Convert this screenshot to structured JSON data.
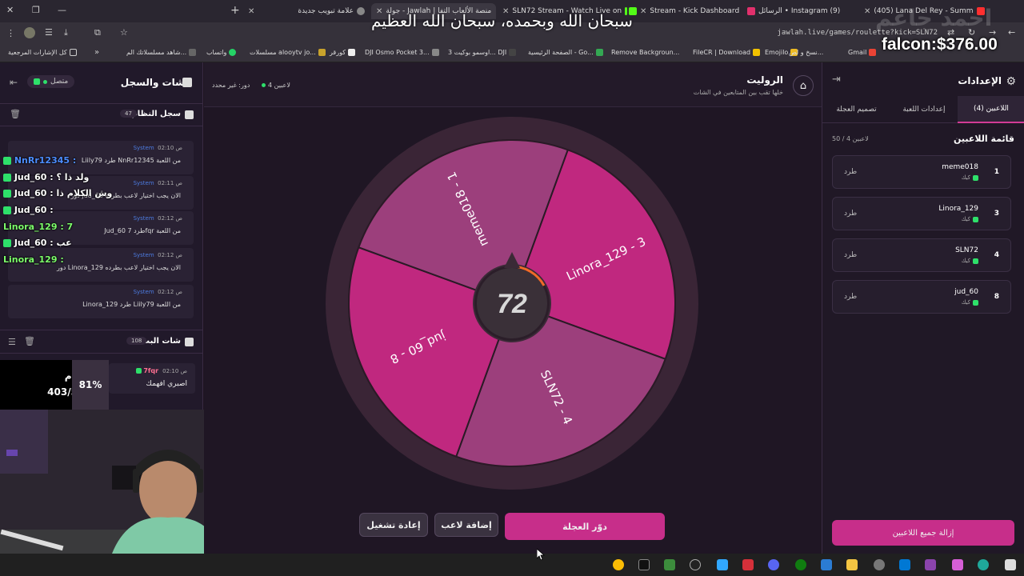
{
  "browser": {
    "tabs": [
      {
        "title": "(405) Lana Del Rey - Summ",
        "icon_color": "#ff2f2f"
      },
      {
        "title": "الرسائل • Instagram (9)",
        "icon_color": "#e1306c"
      },
      {
        "title": "Stream - Kick Dashboard",
        "icon_color": "#53fc18"
      },
      {
        "title": "SLN72 Stream - Watch Live on",
        "icon_color": "#53fc18"
      },
      {
        "title": "جولة - Jawlah | منصة الألعاب التفا",
        "icon_color": "#c72e8a"
      },
      {
        "title": "علامة تبويب جديدة",
        "icon_color": "#888888"
      }
    ],
    "url": "jawlah.live/games/roulette?kick=SLN72",
    "bookmarks": [
      {
        "label": "Gmail"
      },
      {
        "label": "Emojilo"
      },
      {
        "label": "نسخ و لص..."
      },
      {
        "label": "FileCR | Download"
      },
      {
        "label": "Remove Backgroun..."
      },
      {
        "label": "الصفحة الرئيسية - Go..."
      },
      {
        "label": "اوسمو بوكيت 3... DJI"
      },
      {
        "label": "DJI Osmo Pocket 3..."
      },
      {
        "label": "كورقر"
      },
      {
        "label": "مسلسلات alooytv jo..."
      },
      {
        "label": "واتساب"
      },
      {
        "label": "شاهد مسلسلاتك الم..."
      },
      {
        "label": "كل الإشارات المرجعية"
      }
    ]
  },
  "overlay": {
    "dhikr": "سبحان الله وبحمده، سبحان الله العظيم",
    "price": "falcon:$376.00",
    "watermark": "احمد جاعم"
  },
  "left_panel": {
    "title": "الشات والسجل",
    "status": "متصل",
    "system_log": {
      "title": "سجل النظام",
      "count": "47"
    },
    "system_messages": [
      {
        "sender": "System",
        "time": "02:10 ص",
        "text": "Liily79 طرد NnRr12345 من اللعبة"
      },
      {
        "sender": "System",
        "time": "02:11 ص",
        "text": "دور jud_60 الان يجب اختيار لاعب بطرده"
      },
      {
        "sender": "System",
        "time": "02:12 ص",
        "text": "Jud_60 طرد 7fqr من اللعبة"
      },
      {
        "sender": "System",
        "time": "02:12 ص",
        "text": "دور Linora_129 الان يجب اختيار لاعب بطرده"
      },
      {
        "sender": "System",
        "time": "02:12 ص",
        "text": "Linora_129 طرد Liily79 من اللعبة"
      }
    ],
    "overlay_chat": [
      {
        "user": "NnRr12345",
        "text": ":",
        "color": "#4c8dff"
      },
      {
        "user": "Jud_60",
        "text": ": ولد ذا ؟",
        "color": "#ffffff"
      },
      {
        "user": "Jud_60",
        "text": ": وش الكلام ذا",
        "color": "#ffffff"
      },
      {
        "user": "Jud_60",
        "text": ":",
        "color": "#ffffff"
      },
      {
        "user": "Linora_129",
        "text": ": 7",
        "color": "#7dff6b"
      },
      {
        "user": "Jud_60",
        "text": ": عب",
        "color": "#ffffff"
      },
      {
        "user": "Linora_129",
        "text": ":",
        "color": "#7dff6b"
      }
    ],
    "stream_chat": {
      "title": "شات البث",
      "count": "108"
    },
    "stream_messages": [
      {
        "user": "7fqr",
        "time": "02:10 ص",
        "text": "اصبري افهمك"
      }
    ]
  },
  "donation": {
    "label": "كام dji",
    "amount": "403/500$",
    "percent": "81%"
  },
  "main": {
    "title": "الروليت",
    "subtitle": "خلها تقب بين المتابعين في الشات",
    "players_count": "4 لاعبين",
    "turn": "دور: غير محدد",
    "wheel_segments": [
      {
        "label": "Linora_129 - 3",
        "color": "#c0287f"
      },
      {
        "label": "SLN72 - 4",
        "color": "#9c3f7c"
      },
      {
        "label": "jud_60 - 8",
        "color": "#c0287f"
      },
      {
        "label": "meme018 - 1",
        "color": "#9c3f7c"
      }
    ],
    "hub_logo": "72",
    "buttons": {
      "spin": "دوّر العجلة",
      "add_player": "إضافة لاعب",
      "restart": "إعادة تشغيل"
    }
  },
  "right_panel": {
    "title": "الإعدادات",
    "tabs": [
      "اللاعبين (4)",
      "إعدادات اللعبة",
      "تصميم العجلة"
    ],
    "players_title": "قائمة اللاعبين",
    "players_capacity": "50 / 4 لاعبين",
    "players": [
      {
        "name": "meme018",
        "number": "1",
        "platform": "كيك",
        "action": "طرد"
      },
      {
        "name": "Linora_129",
        "number": "3",
        "platform": "كيك",
        "action": "طرد"
      },
      {
        "name": "SLN72",
        "number": "4",
        "platform": "كيك",
        "action": "طرد"
      },
      {
        "name": "jud_60",
        "number": "8",
        "platform": "كيك",
        "action": "طرد"
      }
    ],
    "remove_all": "إزالة جميع اللاعبين"
  }
}
